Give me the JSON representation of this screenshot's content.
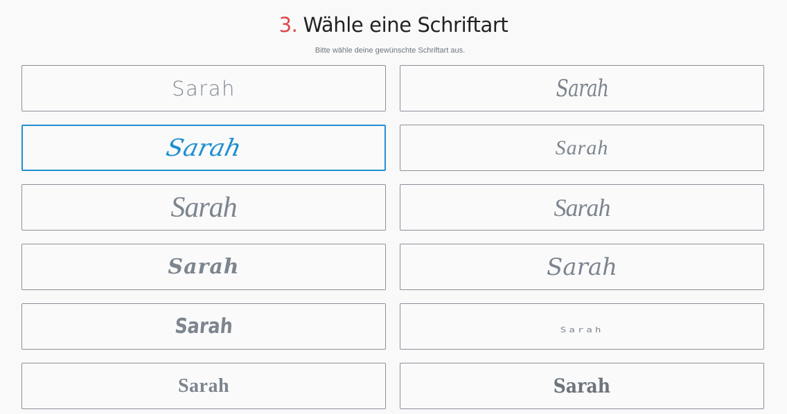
{
  "header": {
    "step_number": "3.",
    "title": "Wähle eine Schriftart",
    "subtitle": "Bitte wähle deine gewünschte Schriftart aus."
  },
  "font_options": [
    {
      "label": "Sarah",
      "selected": false
    },
    {
      "label": "Sarah",
      "selected": false
    },
    {
      "label": "Sarah",
      "selected": true
    },
    {
      "label": "Sarah",
      "selected": false
    },
    {
      "label": "Sarah",
      "selected": false
    },
    {
      "label": "Sarah",
      "selected": false
    },
    {
      "label": "Sarah",
      "selected": false
    },
    {
      "label": "Sarah",
      "selected": false
    },
    {
      "label": "Sarah",
      "selected": false
    },
    {
      "label": "Sarah",
      "selected": false
    },
    {
      "label": "Sarah",
      "selected": false
    },
    {
      "label": "Sarah",
      "selected": false
    }
  ],
  "colors": {
    "accent_selected": "#1f8fcf",
    "step_number": "#e0474c",
    "option_border": "#8a9099",
    "sample_text": "#7d858f"
  }
}
